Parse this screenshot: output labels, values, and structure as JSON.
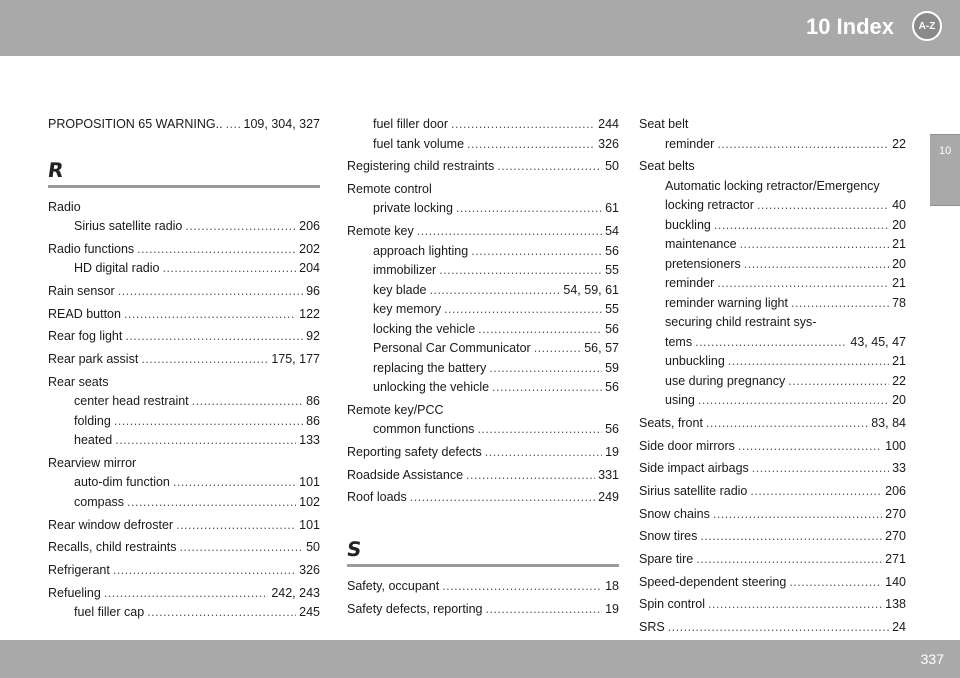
{
  "header": {
    "title": "10 Index",
    "icon_label": "A-Z"
  },
  "side_tab": {
    "label": "10"
  },
  "footer": {
    "page_number": "337"
  },
  "col1": {
    "prop65": {
      "text": "PROPOSITION 65 WARNING..",
      "pages": "109, 304, 327"
    },
    "letter_r": "R",
    "radio": {
      "label": "Radio",
      "sub1": {
        "text": "Sirius satellite radio",
        "pages": "206"
      }
    },
    "radio_functions": {
      "text": "Radio functions",
      "pages": "202",
      "sub1": {
        "text": "HD digital radio",
        "pages": "204"
      }
    },
    "rain_sensor": {
      "text": "Rain sensor",
      "pages": "96"
    },
    "read_button": {
      "text": "READ button",
      "pages": "122"
    },
    "rear_fog": {
      "text": "Rear fog light",
      "pages": "92"
    },
    "rear_park": {
      "text": "Rear park assist",
      "pages": "175, 177"
    },
    "rear_seats": {
      "label": "Rear seats",
      "sub1": {
        "text": "center head restraint",
        "pages": "86"
      },
      "sub2": {
        "text": "folding",
        "pages": "86"
      },
      "sub3": {
        "text": "heated",
        "pages": "133"
      }
    },
    "rearview": {
      "label": "Rearview mirror",
      "sub1": {
        "text": "auto-dim function",
        "pages": "101"
      },
      "sub2": {
        "text": "compass",
        "pages": "102"
      }
    },
    "rear_window": {
      "text": "Rear window defroster",
      "pages": "101"
    },
    "recalls": {
      "text": "Recalls, child restraints",
      "pages": "50"
    },
    "refrigerant": {
      "text": "Refrigerant",
      "pages": "326"
    },
    "refueling": {
      "text": "Refueling",
      "pages": "242, 243",
      "sub1": {
        "text": "fuel filler cap",
        "pages": "245"
      }
    }
  },
  "col2": {
    "fuel_door": {
      "text": "fuel filler door",
      "pages": "244"
    },
    "fuel_tank": {
      "text": "fuel tank volume",
      "pages": "326"
    },
    "registering": {
      "text": "Registering child restraints",
      "pages": "50"
    },
    "remote_control": {
      "label": "Remote control",
      "sub1": {
        "text": "private locking",
        "pages": "61"
      }
    },
    "remote_key": {
      "text": "Remote key",
      "pages": "54",
      "sub1": {
        "text": "approach lighting",
        "pages": "56"
      },
      "sub2": {
        "text": "immobilizer",
        "pages": "55"
      },
      "sub3": {
        "text": "key blade",
        "pages": "54, 59, 61"
      },
      "sub4": {
        "text": "key memory",
        "pages": "55"
      },
      "sub5": {
        "text": "locking the vehicle",
        "pages": "56"
      },
      "sub6": {
        "text": "Personal Car Communicator",
        "pages": "56, 57"
      },
      "sub7": {
        "text": "replacing the battery",
        "pages": "59"
      },
      "sub8": {
        "text": "unlocking the vehicle",
        "pages": "56"
      }
    },
    "remote_pcc": {
      "label": "Remote key/PCC",
      "sub1": {
        "text": "common functions",
        "pages": "56"
      }
    },
    "reporting": {
      "text": "Reporting safety defects",
      "pages": "19"
    },
    "roadside": {
      "text": "Roadside Assistance",
      "pages": "331"
    },
    "roof": {
      "text": "Roof loads",
      "pages": "249"
    },
    "letter_s": "S",
    "safety_occ": {
      "text": "Safety, occupant",
      "pages": "18"
    },
    "safety_def": {
      "text": "Safety defects, reporting",
      "pages": "19"
    }
  },
  "col3": {
    "seat_belt": {
      "label": "Seat belt",
      "sub1": {
        "text": "reminder",
        "pages": "22"
      }
    },
    "seat_belts": {
      "label": "Seat belts",
      "sub0": "Automatic locking retractor/Emergency",
      "sub1": {
        "text": "locking retractor",
        "pages": "40"
      },
      "sub2": {
        "text": "buckling",
        "pages": "20"
      },
      "sub3": {
        "text": "maintenance",
        "pages": "21"
      },
      "sub4": {
        "text": "pretensioners",
        "pages": "20"
      },
      "sub5": {
        "text": "reminder",
        "pages": "21"
      },
      "sub6": {
        "text": "reminder warning light",
        "pages": "78"
      },
      "sub7a": "securing child restraint sys-",
      "sub7": {
        "text": "tems",
        "pages": "43, 45, 47"
      },
      "sub8": {
        "text": "unbuckling",
        "pages": "21"
      },
      "sub9": {
        "text": "use during pregnancy",
        "pages": "22"
      },
      "sub10": {
        "text": "using",
        "pages": "20"
      }
    },
    "seats_front": {
      "text": "Seats, front",
      "pages": "83, 84"
    },
    "side_door": {
      "text": "Side door mirrors",
      "pages": "100"
    },
    "side_impact": {
      "text": "Side impact airbags",
      "pages": "33"
    },
    "sirius": {
      "text": "Sirius satellite radio",
      "pages": "206"
    },
    "snow_chains": {
      "text": "Snow chains",
      "pages": "270"
    },
    "snow_tires": {
      "text": "Snow tires",
      "pages": "270"
    },
    "spare": {
      "text": "Spare tire",
      "pages": "271"
    },
    "speed_steer": {
      "text": "Speed-dependent steering",
      "pages": "140"
    },
    "spin": {
      "text": "Spin control",
      "pages": "138"
    },
    "srs": {
      "text": "SRS",
      "pages": "24"
    }
  }
}
